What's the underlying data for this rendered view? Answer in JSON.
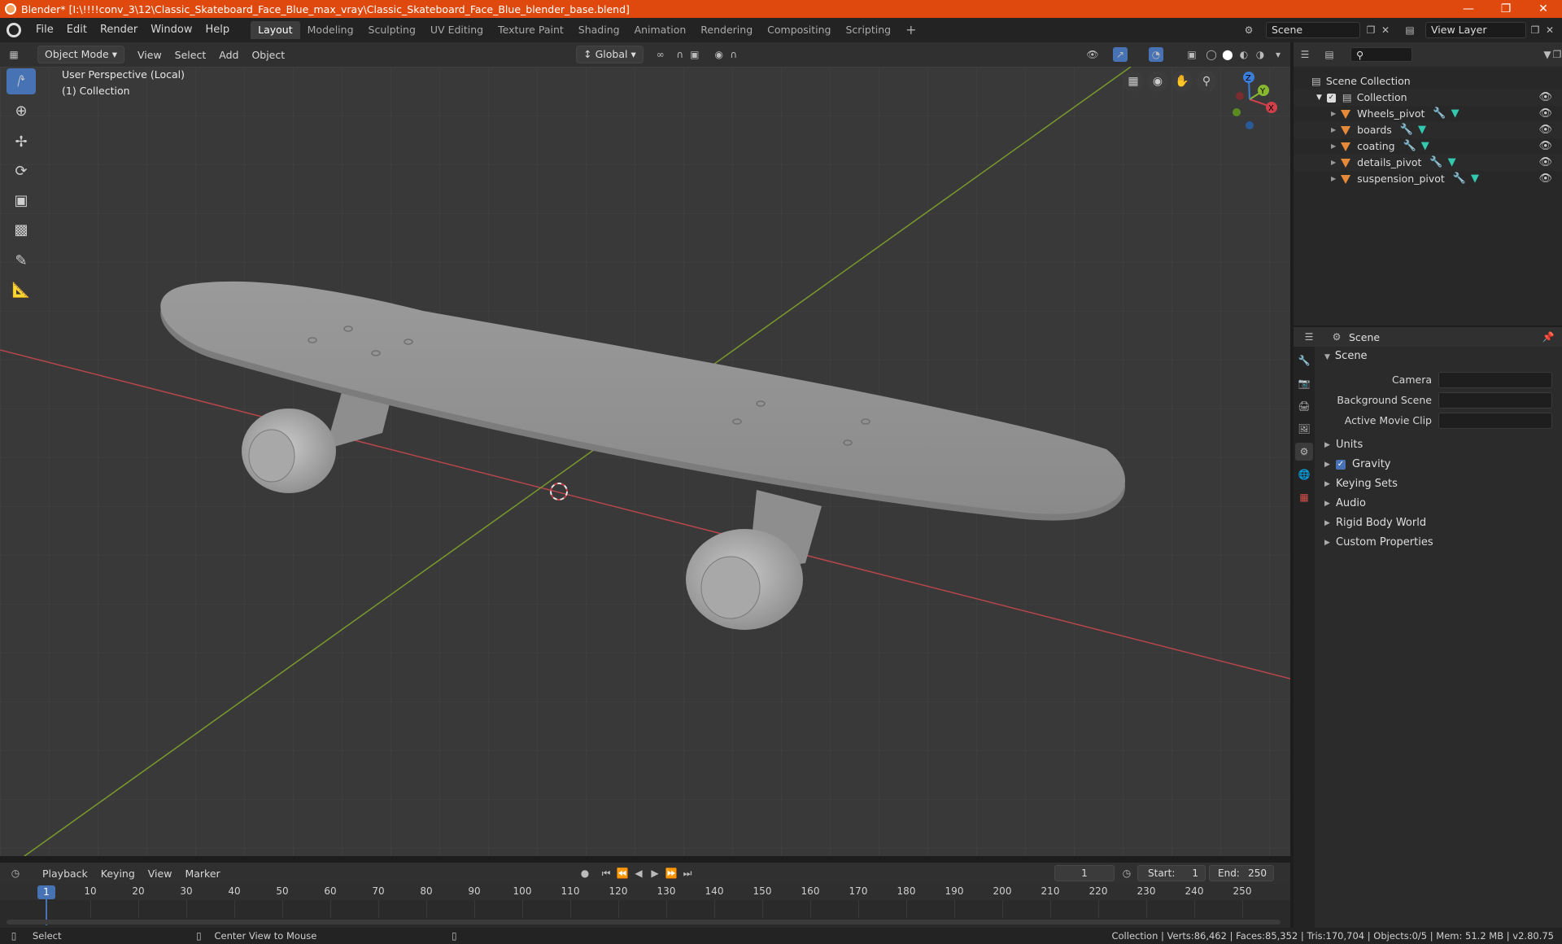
{
  "title": "Blender* [I:\\!!!!conv_3\\12\\Classic_Skateboard_Face_Blue_max_vray\\Classic_Skateboard_Face_Blue_blender_base.blend]",
  "menu": [
    "File",
    "Edit",
    "Render",
    "Window",
    "Help"
  ],
  "workspaces": [
    "Layout",
    "Modeling",
    "Sculpting",
    "UV Editing",
    "Texture Paint",
    "Shading",
    "Animation",
    "Rendering",
    "Compositing",
    "Scripting"
  ],
  "scene_name": "Scene",
  "view_layer": "View Layer",
  "viewport": {
    "mode": "Object Mode",
    "menus": [
      "View",
      "Select",
      "Add",
      "Object"
    ],
    "transform": "Global",
    "perspective": "User Perspective (Local)",
    "collection": "(1) Collection",
    "gizmo": {
      "x": "X",
      "y": "Y",
      "z": "Z"
    }
  },
  "outliner": {
    "root": "Scene Collection",
    "collection": "Collection",
    "objects": [
      "Wheels_pivot",
      "boards",
      "coating",
      "details_pivot",
      "suspension_pivot"
    ]
  },
  "properties": {
    "header": "Scene",
    "section": "Scene",
    "rows": [
      {
        "label": "Camera"
      },
      {
        "label": "Background Scene"
      },
      {
        "label": "Active Movie Clip"
      }
    ],
    "subsections": [
      "Units",
      "Gravity",
      "Keying Sets",
      "Audio",
      "Rigid Body World",
      "Custom Properties"
    ]
  },
  "timeline": {
    "menus": [
      "Playback",
      "Keying",
      "View",
      "Marker"
    ],
    "current_frame": "1",
    "start_label": "Start:",
    "start": "1",
    "end_label": "End:",
    "end": "250",
    "ticks": [
      "10",
      "20",
      "30",
      "40",
      "50",
      "60",
      "70",
      "80",
      "90",
      "100",
      "110",
      "120",
      "130",
      "140",
      "150",
      "160",
      "170",
      "180",
      "190",
      "200",
      "210",
      "220",
      "230",
      "240",
      "250"
    ]
  },
  "status": {
    "left": "Select",
    "middle": "Center View to Mouse",
    "right": "Collection | Verts:86,462 | Faces:85,352 | Tris:170,704 | Objects:0/5 | Mem: 51.2 MB | v2.80.75"
  },
  "colors": {
    "accent": "#4772b3",
    "titlebar": "#e0490d",
    "x_axis": "#d0404a",
    "y_axis": "#8ab730"
  }
}
